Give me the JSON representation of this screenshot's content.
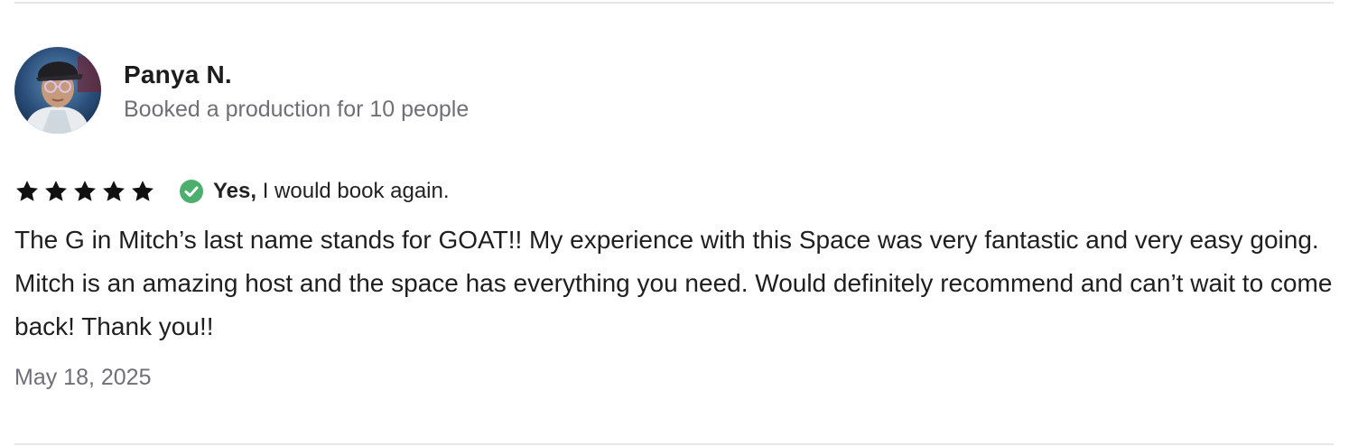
{
  "review": {
    "reviewer_name": "Panya N.",
    "booking_info": "Booked a production for 10 people",
    "rating": 5,
    "rating_max": 5,
    "book_again_bold": "Yes,",
    "book_again_rest": " I would book again.",
    "text": "The G in Mitch’s last name stands for GOAT!! My experience with this Space was very fantastic and very easy going. Mitch is an amazing host and the space has everything you need. Would definitely recommend and can’t wait to come back! Thank you!!",
    "date": "May 18, 2025"
  },
  "icons": {
    "star": "star-icon",
    "check": "check-circle-icon"
  },
  "colors": {
    "star": "#111111",
    "check_green": "#4caf6e",
    "secondary_text": "#6f6f78",
    "divider": "#e6e6e6"
  }
}
